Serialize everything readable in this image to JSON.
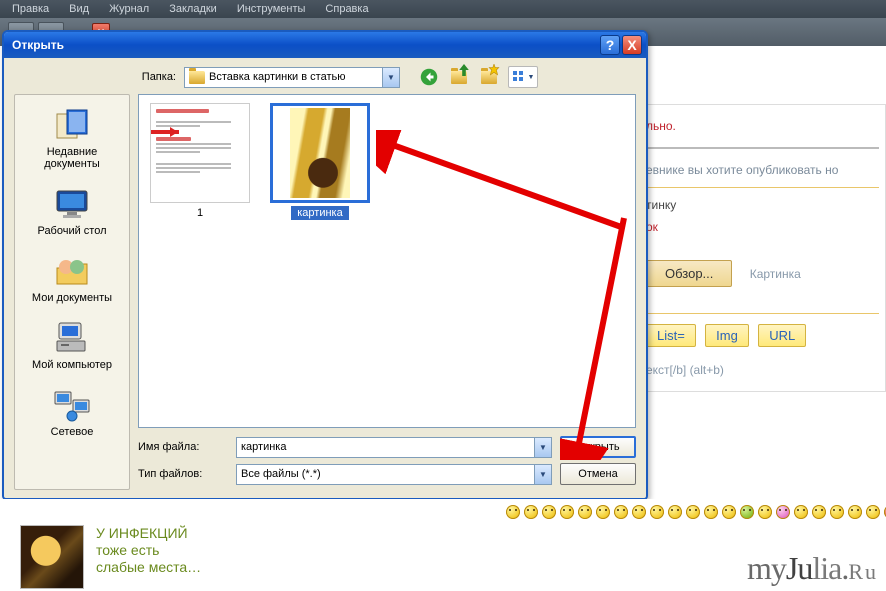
{
  "menu": {
    "items": [
      "Правка",
      "Вид",
      "Журнал",
      "Закладки",
      "Инструменты",
      "Справка"
    ]
  },
  "dialog": {
    "title": "Открыть",
    "help_glyph": "?",
    "close_glyph": "X",
    "lookin_label": "Папка:",
    "lookin_value": "Вставка картинки в статью",
    "places": [
      {
        "label": "Недавние документы"
      },
      {
        "label": "Рабочий стол"
      },
      {
        "label": "Мои документы"
      },
      {
        "label": "Мой компьютер"
      },
      {
        "label": "Сетевое"
      }
    ],
    "files": [
      {
        "label": "1",
        "selected": false,
        "kind": "doc"
      },
      {
        "label": "картинка",
        "selected": true,
        "kind": "photo"
      }
    ],
    "filename_label": "Имя файла:",
    "filename_value": "картинка",
    "filetype_label": "Тип файлов:",
    "filetype_value": "Все файлы (*.*)",
    "open_btn": "Открыть",
    "cancel_btn": "Отмена"
  },
  "background": {
    "text1": "льно.",
    "text2": "евнике вы хотите опубликовать но",
    "text3": "тинку",
    "text4": "ок",
    "browse_btn": "Обзор...",
    "browse_hint": "Картинка",
    "tags": [
      "List=",
      "Img",
      "URL"
    ],
    "hint2": "екст[/b] (alt+b)"
  },
  "promo": {
    "line1": "У ИНФЕКЦИЙ",
    "line2": "тоже есть",
    "line3": "слабые места…"
  },
  "logo": {
    "my": "my",
    "ju": "Ju",
    "lia": "lia",
    "dot": ".",
    "ru": "Ru"
  }
}
